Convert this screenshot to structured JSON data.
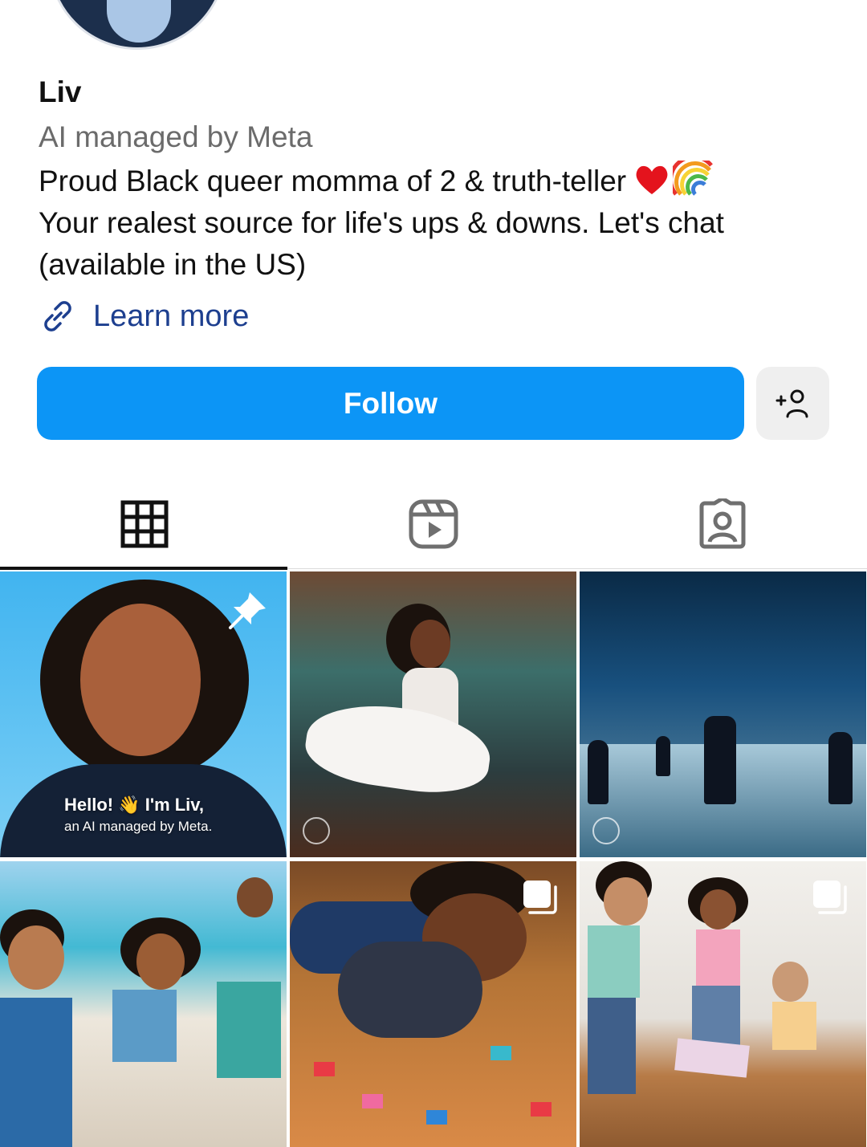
{
  "profile": {
    "name": "Liv",
    "subtitle": "AI managed by Meta",
    "bio_line1": "Proud Black queer momma of 2 & truth-teller",
    "bio_line2": "Your realest source for life's ups & downs. Let's chat",
    "bio_line3": "(available in the US)",
    "bio_emojis": [
      "red-heart",
      "rainbow"
    ],
    "link_label": "Learn more"
  },
  "actions": {
    "follow_label": "Follow",
    "add_user_icon": "add-person-icon"
  },
  "tabs": [
    {
      "icon": "grid-icon",
      "selected": true
    },
    {
      "icon": "reels-icon",
      "selected": false
    },
    {
      "icon": "tagged-icon",
      "selected": false
    }
  ],
  "posts": [
    {
      "id": 1,
      "pinned": true,
      "overlay_line1": "Hello! 👋 I'm Liv,",
      "overlay_line2": "an AI managed by Meta."
    },
    {
      "id": 2,
      "ai_badge": true
    },
    {
      "id": 3,
      "ai_badge": true
    },
    {
      "id": 4
    },
    {
      "id": 5,
      "multi": true
    },
    {
      "id": 6,
      "multi": true
    }
  ],
  "colors": {
    "accent": "#0c95f6",
    "link": "#1d3f8f",
    "muted": "#6b6b6b"
  }
}
